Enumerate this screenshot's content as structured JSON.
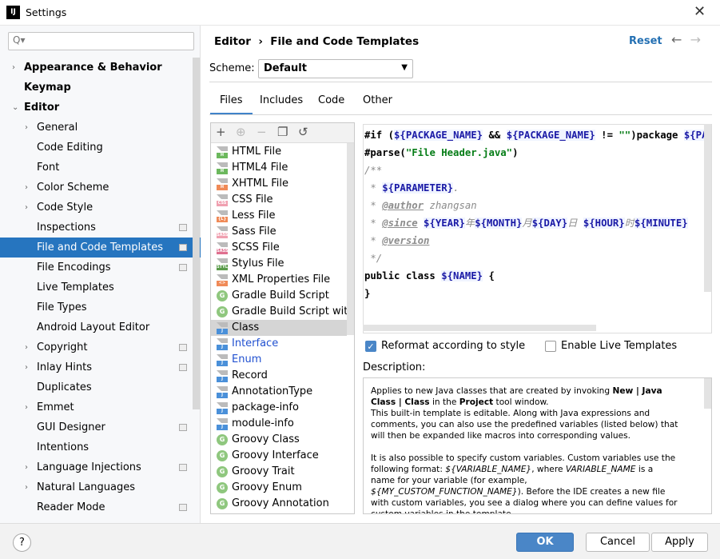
{
  "window": {
    "title": "Settings",
    "app_icon": "IJ"
  },
  "sidebar": {
    "search_placeholder": "Q▾",
    "items": [
      {
        "label": "Appearance & Behavior",
        "level": 0,
        "arrow": "›",
        "bold": true
      },
      {
        "label": "Keymap",
        "level": 0,
        "bold": true
      },
      {
        "label": "Editor",
        "level": 0,
        "arrow": "⌄",
        "bold": true
      },
      {
        "label": "General",
        "level": 1,
        "arrow": "›"
      },
      {
        "label": "Code Editing",
        "level": 1
      },
      {
        "label": "Font",
        "level": 1
      },
      {
        "label": "Color Scheme",
        "level": 1,
        "arrow": "›"
      },
      {
        "label": "Code Style",
        "level": 1,
        "arrow": "›"
      },
      {
        "label": "Inspections",
        "level": 1,
        "badge": true
      },
      {
        "label": "File and Code Templates",
        "level": 1,
        "badge": true,
        "selected": true
      },
      {
        "label": "File Encodings",
        "level": 1,
        "badge": true
      },
      {
        "label": "Live Templates",
        "level": 1
      },
      {
        "label": "File Types",
        "level": 1
      },
      {
        "label": "Android Layout Editor",
        "level": 1
      },
      {
        "label": "Copyright",
        "level": 1,
        "arrow": "›",
        "badge": true
      },
      {
        "label": "Inlay Hints",
        "level": 1,
        "arrow": "›",
        "badge": true
      },
      {
        "label": "Duplicates",
        "level": 1
      },
      {
        "label": "Emmet",
        "level": 1,
        "arrow": "›"
      },
      {
        "label": "GUI Designer",
        "level": 1,
        "badge": true
      },
      {
        "label": "Intentions",
        "level": 1
      },
      {
        "label": "Language Injections",
        "level": 1,
        "arrow": "›",
        "badge": true
      },
      {
        "label": "Natural Languages",
        "level": 1,
        "arrow": "›"
      },
      {
        "label": "Reader Mode",
        "level": 1,
        "badge": true
      }
    ]
  },
  "header": {
    "breadcrumb_parent": "Editor",
    "separator": "›",
    "breadcrumb_current": "File and Code Templates",
    "reset": "Reset",
    "back": "←",
    "forward": "→"
  },
  "scheme": {
    "label": "Scheme:",
    "value": "Default"
  },
  "tabs": [
    {
      "label": "Files",
      "selected": true
    },
    {
      "label": "Includes"
    },
    {
      "label": "Code"
    },
    {
      "label": "Other"
    }
  ],
  "toolbar": {
    "add": "+",
    "add_child": "⊕",
    "remove": "−",
    "copy": "❐",
    "reset": "↺"
  },
  "templates": [
    {
      "label": "HTML File",
      "icon": "H",
      "color": "#6cb85d"
    },
    {
      "label": "HTML4 File",
      "icon": "H",
      "color": "#6cb85d"
    },
    {
      "label": "XHTML File",
      "icon": "H",
      "color": "#f08a57"
    },
    {
      "label": "CSS File",
      "icon": "CSS",
      "color": "#f0a0b0"
    },
    {
      "label": "Less File",
      "icon": "{L}",
      "color": "#f08a57"
    },
    {
      "label": "Sass File",
      "icon": "SASS",
      "color": "#f0a0b0"
    },
    {
      "label": "SCSS File",
      "icon": "SASS",
      "color": "#e07090"
    },
    {
      "label": "Stylus File",
      "icon": "STYL",
      "color": "#5a9b4a"
    },
    {
      "label": "XML Properties File",
      "icon": "<>",
      "color": "#f08a57"
    },
    {
      "label": "Gradle Build Script",
      "icon": "G",
      "kind": "circle"
    },
    {
      "label": "Gradle Build Script with wrapper",
      "icon": "G",
      "kind": "circle"
    },
    {
      "label": "Class",
      "icon": "J",
      "color": "#4a90d9",
      "selected": true
    },
    {
      "label": "Interface",
      "icon": "J",
      "color": "#4a90d9",
      "link": true
    },
    {
      "label": "Enum",
      "icon": "J",
      "color": "#4a90d9",
      "link": true
    },
    {
      "label": "Record",
      "icon": "J",
      "color": "#4a90d9"
    },
    {
      "label": "AnnotationType",
      "icon": "J",
      "color": "#4a90d9"
    },
    {
      "label": "package-info",
      "icon": "J",
      "color": "#4a90d9"
    },
    {
      "label": "module-info",
      "icon": "J",
      "color": "#4a90d9"
    },
    {
      "label": "Groovy Class",
      "icon": "G",
      "kind": "circle"
    },
    {
      "label": "Groovy Interface",
      "icon": "G",
      "kind": "circle"
    },
    {
      "label": "Groovy Trait",
      "icon": "G",
      "kind": "circle"
    },
    {
      "label": "Groovy Enum",
      "icon": "G",
      "kind": "circle"
    },
    {
      "label": "Groovy Annotation",
      "icon": "G",
      "kind": "circle"
    }
  ],
  "editor": {
    "lines": [
      "#if (${PACKAGE_NAME} && ${PACKAGE_NAME} != \"\")package ${PACKAGE_NAME};#end",
      "#parse(\"File Header.java\")",
      "/**",
      " * ${PARAMETER}.",
      " * @author zhangsan",
      " * @since ${YEAR}年${MONTH}月${DAY}日 ${HOUR}时${MINUTE}",
      " * @version",
      " */",
      "public class ${NAME} {",
      "}"
    ]
  },
  "options": {
    "reformat": {
      "label": "Reformat according to style",
      "checked": true
    },
    "live_templates": {
      "label": "Enable Live Templates",
      "checked": false
    }
  },
  "description": {
    "label": "Description:",
    "html": "Applies to new Java classes that are created by invoking <b>New | Java Class | Class</b> in the <b>Project</b> tool window.<br>This built-in template is editable. Along with Java expressions and comments, you can also use the predefined variables (listed below) that will then be expanded like macros into corresponding values.<br><br>It is also possible to specify custom variables. Custom variables use the following format: <i>${VARIABLE_NAME}</i>, where <i>VARIABLE_NAME</i> is a name for your variable (for example, <i>${MY_CUSTOM_FUNCTION_NAME}</i>). Before the IDE creates a new file with custom variables, you see a dialog where you can define values for custom variables in the template."
  },
  "footer": {
    "help": "?",
    "ok": "OK",
    "cancel": "Cancel",
    "apply": "Apply"
  },
  "colors": {
    "accent": "#2675bf",
    "primary_button": "#4a86c7"
  }
}
